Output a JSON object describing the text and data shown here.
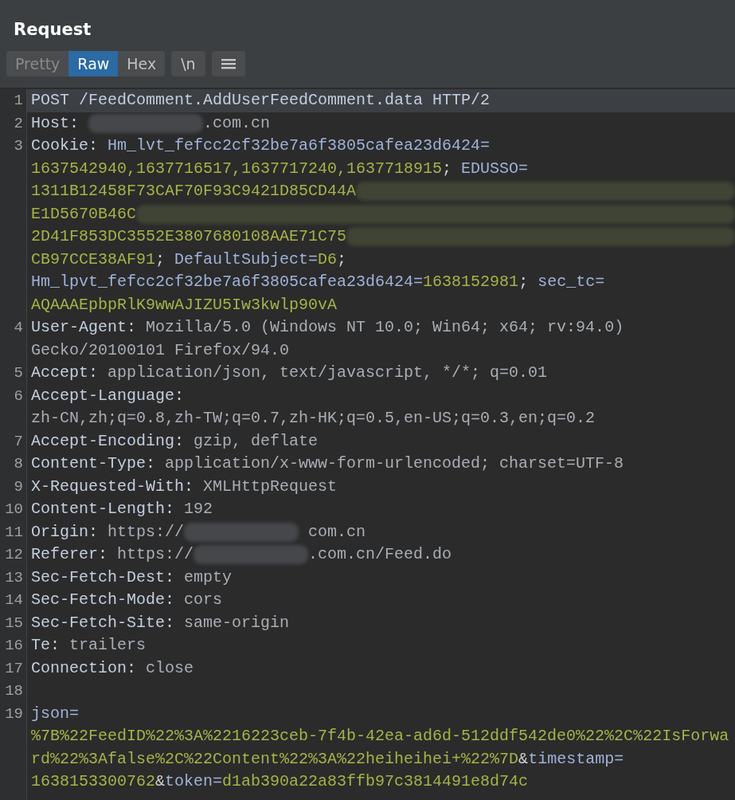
{
  "panel": {
    "title": "Request"
  },
  "tabs": [
    {
      "label": "Pretty",
      "selected": false,
      "disabled": true
    },
    {
      "label": "Raw",
      "selected": true,
      "disabled": false
    },
    {
      "label": "Hex",
      "selected": false,
      "disabled": false
    }
  ],
  "newline_button": {
    "label": "\\n"
  },
  "lines": [
    {
      "number": "1",
      "current": true,
      "rows": [
        {
          "segments": [
            {
              "kind": "name",
              "text": "POST /FeedComment.AddUserFeedComment.data HTTP/2"
            }
          ]
        }
      ]
    },
    {
      "number": "2",
      "current": false,
      "rows": [
        {
          "segments": [
            {
              "kind": "name",
              "text": "Host: "
            },
            {
              "kind": "redacted"
            },
            {
              "kind": "value",
              "text": ".com.cn"
            }
          ]
        }
      ]
    },
    {
      "number": "3",
      "current": false,
      "rows": [
        {
          "segments": [
            {
              "kind": "name",
              "text": "Cookie: "
            },
            {
              "kind": "key",
              "text": "Hm_lvt_fefcc2cf32be7a6f3805cafea23d6424="
            }
          ]
        },
        {
          "segments": [
            {
              "kind": "val",
              "text": "1637542940,1637716517,1637717240,1637718915"
            },
            {
              "kind": "plain",
              "text": "; "
            },
            {
              "kind": "key",
              "text": "EDUSSO="
            }
          ]
        },
        {
          "segments": [
            {
              "kind": "val",
              "text": "1311B12458F73CAF70F93C9421D85CD44A"
            },
            {
              "kind": "redacted"
            }
          ]
        },
        {
          "segments": [
            {
              "kind": "val",
              "text": "E1D5670B46C"
            },
            {
              "kind": "redacted"
            }
          ]
        },
        {
          "segments": [
            {
              "kind": "val",
              "text": "2D41F853DC3552E3807680108AAE71C75"
            },
            {
              "kind": "redacted"
            }
          ]
        },
        {
          "segments": [
            {
              "kind": "val",
              "text": "CB97CCE38AF91"
            },
            {
              "kind": "plain",
              "text": "; "
            },
            {
              "kind": "key",
              "text": "DefaultSubject="
            },
            {
              "kind": "val",
              "text": "D6"
            },
            {
              "kind": "plain",
              "text": ";"
            }
          ]
        },
        {
          "segments": [
            {
              "kind": "key",
              "text": "Hm_lpvt_fefcc2cf32be7a6f3805cafea23d6424="
            },
            {
              "kind": "val",
              "text": "1638152981"
            },
            {
              "kind": "plain",
              "text": "; "
            },
            {
              "kind": "key",
              "text": "sec_tc="
            }
          ]
        },
        {
          "segments": [
            {
              "kind": "val",
              "text": "AQAAAEpbpRlK9wwAJIZU5Iw3kwlp90vA"
            }
          ]
        }
      ]
    },
    {
      "number": "4",
      "current": false,
      "rows": [
        {
          "segments": [
            {
              "kind": "name",
              "text": "User-Agent: "
            },
            {
              "kind": "value",
              "text": "Mozilla/5.0 (Windows NT 10.0; Win64; x64; rv:94.0)"
            }
          ]
        },
        {
          "segments": [
            {
              "kind": "value",
              "text": "Gecko/20100101 Firefox/94.0"
            }
          ]
        }
      ]
    },
    {
      "number": "5",
      "current": false,
      "rows": [
        {
          "segments": [
            {
              "kind": "name",
              "text": "Accept: "
            },
            {
              "kind": "value",
              "text": "application/json, text/javascript, */*; q=0.01"
            }
          ]
        }
      ]
    },
    {
      "number": "6",
      "current": false,
      "rows": [
        {
          "segments": [
            {
              "kind": "name",
              "text": "Accept-Language:"
            }
          ]
        },
        {
          "segments": [
            {
              "kind": "value",
              "text": "zh-CN,zh;q=0.8,zh-TW;q=0.7,zh-HK;q=0.5,en-US;q=0.3,en;q=0.2"
            }
          ]
        }
      ]
    },
    {
      "number": "7",
      "current": false,
      "rows": [
        {
          "segments": [
            {
              "kind": "name",
              "text": "Accept-Encoding: "
            },
            {
              "kind": "value",
              "text": "gzip, deflate"
            }
          ]
        }
      ]
    },
    {
      "number": "8",
      "current": false,
      "rows": [
        {
          "segments": [
            {
              "kind": "name",
              "text": "Content-Type: "
            },
            {
              "kind": "value",
              "text": "application/x-www-form-urlencoded; charset=UTF-8"
            }
          ]
        }
      ]
    },
    {
      "number": "9",
      "current": false,
      "rows": [
        {
          "segments": [
            {
              "kind": "name",
              "text": "X-Requested-With: "
            },
            {
              "kind": "value",
              "text": "XMLHttpRequest"
            }
          ]
        }
      ]
    },
    {
      "number": "10",
      "current": false,
      "rows": [
        {
          "segments": [
            {
              "kind": "name",
              "text": "Content-Length: "
            },
            {
              "kind": "value",
              "text": "192"
            }
          ]
        }
      ]
    },
    {
      "number": "11",
      "current": false,
      "rows": [
        {
          "segments": [
            {
              "kind": "name",
              "text": "Origin: "
            },
            {
              "kind": "value",
              "text": "https://"
            },
            {
              "kind": "redacted"
            },
            {
              "kind": "value",
              "text": " com.cn"
            }
          ]
        }
      ]
    },
    {
      "number": "12",
      "current": false,
      "rows": [
        {
          "segments": [
            {
              "kind": "name",
              "text": "Referer: "
            },
            {
              "kind": "value",
              "text": "https://"
            },
            {
              "kind": "redacted"
            },
            {
              "kind": "value",
              "text": ".com.cn/Feed.do"
            }
          ]
        }
      ]
    },
    {
      "number": "13",
      "current": false,
      "rows": [
        {
          "segments": [
            {
              "kind": "name",
              "text": "Sec-Fetch-Dest: "
            },
            {
              "kind": "value",
              "text": "empty"
            }
          ]
        }
      ]
    },
    {
      "number": "14",
      "current": false,
      "rows": [
        {
          "segments": [
            {
              "kind": "name",
              "text": "Sec-Fetch-Mode: "
            },
            {
              "kind": "value",
              "text": "cors"
            }
          ]
        }
      ]
    },
    {
      "number": "15",
      "current": false,
      "rows": [
        {
          "segments": [
            {
              "kind": "name",
              "text": "Sec-Fetch-Site: "
            },
            {
              "kind": "value",
              "text": "same-origin"
            }
          ]
        }
      ]
    },
    {
      "number": "16",
      "current": false,
      "rows": [
        {
          "segments": [
            {
              "kind": "name",
              "text": "Te: "
            },
            {
              "kind": "value",
              "text": "trailers"
            }
          ]
        }
      ]
    },
    {
      "number": "17",
      "current": false,
      "rows": [
        {
          "segments": [
            {
              "kind": "name",
              "text": "Connection: "
            },
            {
              "kind": "value",
              "text": "close"
            }
          ]
        }
      ]
    },
    {
      "number": "18",
      "current": false
    },
    {
      "number": "19",
      "current": false,
      "rows": [
        {
          "segments": [
            {
              "kind": "key",
              "text": "json="
            }
          ]
        },
        {
          "segments": [
            {
              "kind": "val",
              "text": "%7B%22FeedID%22%3A%2216223ceb-7f4b-42ea-ad6d-512ddf542de0%22%2C%22IsForwa"
            }
          ]
        },
        {
          "segments": [
            {
              "kind": "val",
              "text": "rd%22%3Afalse%2C%22Content%22%3A%22heiheihei+%22%7D"
            },
            {
              "kind": "plain",
              "text": "&"
            },
            {
              "kind": "key",
              "text": "timestamp="
            }
          ]
        },
        {
          "segments": [
            {
              "kind": "val",
              "text": "1638153300762"
            },
            {
              "kind": "plain",
              "text": "&"
            },
            {
              "kind": "key",
              "text": "token="
            },
            {
              "kind": "val",
              "text": "d1ab390a22a83ffb97c3814491e8d74c"
            }
          ]
        }
      ]
    }
  ]
}
